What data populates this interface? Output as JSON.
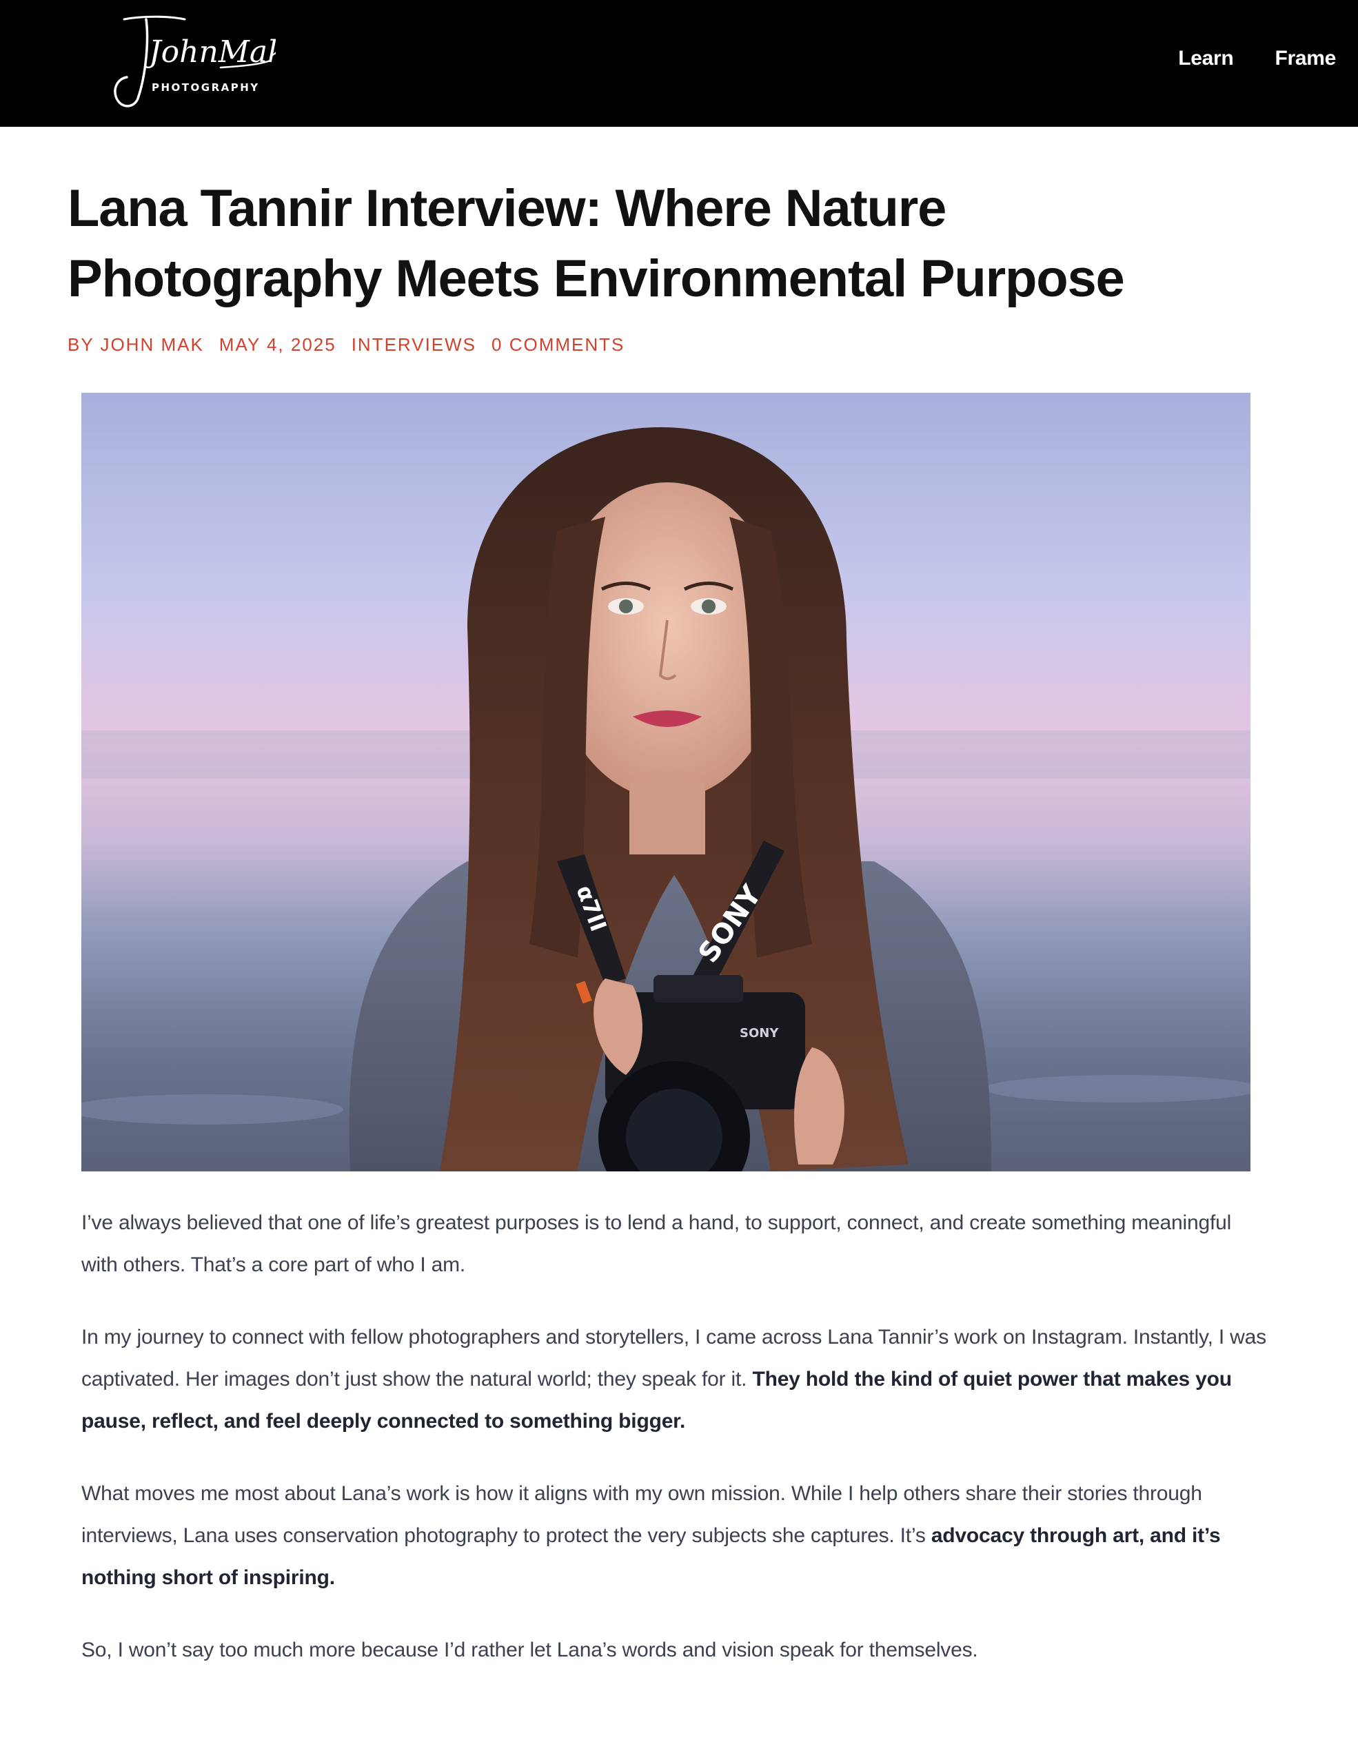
{
  "header": {
    "logo_name": "JohnMak",
    "logo_sub": "PHOTOGRAPHY",
    "nav": [
      {
        "label": "Learn"
      },
      {
        "label": "Frame"
      }
    ]
  },
  "post": {
    "title": "Lana Tannir Interview: Where Nature Photography Meets Environmental Purpose",
    "meta": {
      "author": "BY JOHN MAK",
      "date": "MAY 4, 2025",
      "category": "INTERVIEWS",
      "comments": "0 COMMENTS"
    },
    "image": {
      "strap_left": "α7II",
      "strap_right": "SONY",
      "camera_brand": "SONY"
    },
    "paragraphs": [
      {
        "text": "I’ve always believed that one of life’s greatest purposes is to lend a hand, to support, connect, and create something meaningful with others. That’s a core part of who I am.",
        "bold": ""
      },
      {
        "text": "In my journey to connect with fellow photographers and storytellers, I came across Lana Tannir’s work on Instagram. Instantly, I was captivated. Her images don’t just show the natural world; they speak for it. ",
        "bold": "They hold the kind of quiet power that makes you pause, reflect, and feel deeply connected to something bigger."
      },
      {
        "text": "What moves me most about Lana’s work is how it aligns with my own mission. While I help others share their stories through interviews, Lana uses conservation photography to protect the very subjects she captures. It’s ",
        "bold": "advocacy through art, and it’s nothing short of inspiring."
      },
      {
        "text": "So, I won’t say too much more because I’d rather let Lana’s words and vision speak for themselves.",
        "bold": ""
      }
    ]
  },
  "colors": {
    "header_bg": "#000000",
    "accent": "#d2412d",
    "title": "#111111",
    "body": "#3b4150"
  }
}
